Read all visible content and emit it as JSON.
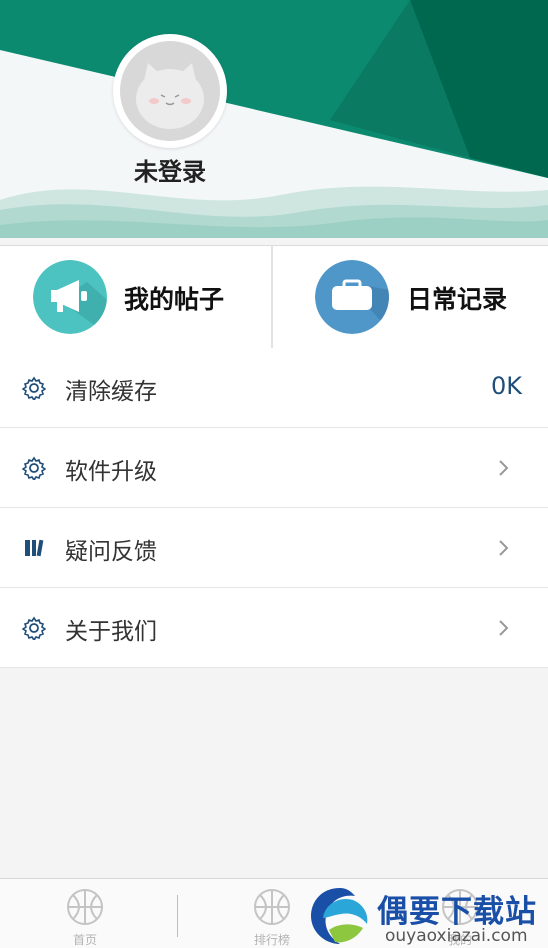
{
  "profile": {
    "login_status": "未登录"
  },
  "quick_actions": [
    {
      "label": "我的帖子",
      "icon": "megaphone-icon",
      "color": "#4cc3c0"
    },
    {
      "label": "日常记录",
      "icon": "briefcase-icon",
      "color": "#4f97c9"
    }
  ],
  "menu": [
    {
      "label": "清除缓存",
      "icon": "gear-icon",
      "value": "0K"
    },
    {
      "label": "软件升级",
      "icon": "gear-icon",
      "arrow": "chevron-right-icon"
    },
    {
      "label": "疑问反馈",
      "icon": "books-icon",
      "arrow": "chevron-right-icon"
    },
    {
      "label": "关于我们",
      "icon": "gear-icon",
      "arrow": "chevron-right-icon"
    }
  ],
  "tabbar": {
    "items": [
      {
        "label": "首页",
        "icon": "basketball-icon"
      },
      {
        "label": "排行榜",
        "icon": "basketball-icon"
      },
      {
        "label": "我的",
        "icon": "basketball-icon"
      }
    ]
  },
  "watermark": {
    "title": "偶要下载站",
    "url": "ouyaoxiazai.com"
  },
  "colors": {
    "header_dark": "#006e54",
    "header_mid": "#0f8a72",
    "accent_text": "#1f4e79"
  }
}
